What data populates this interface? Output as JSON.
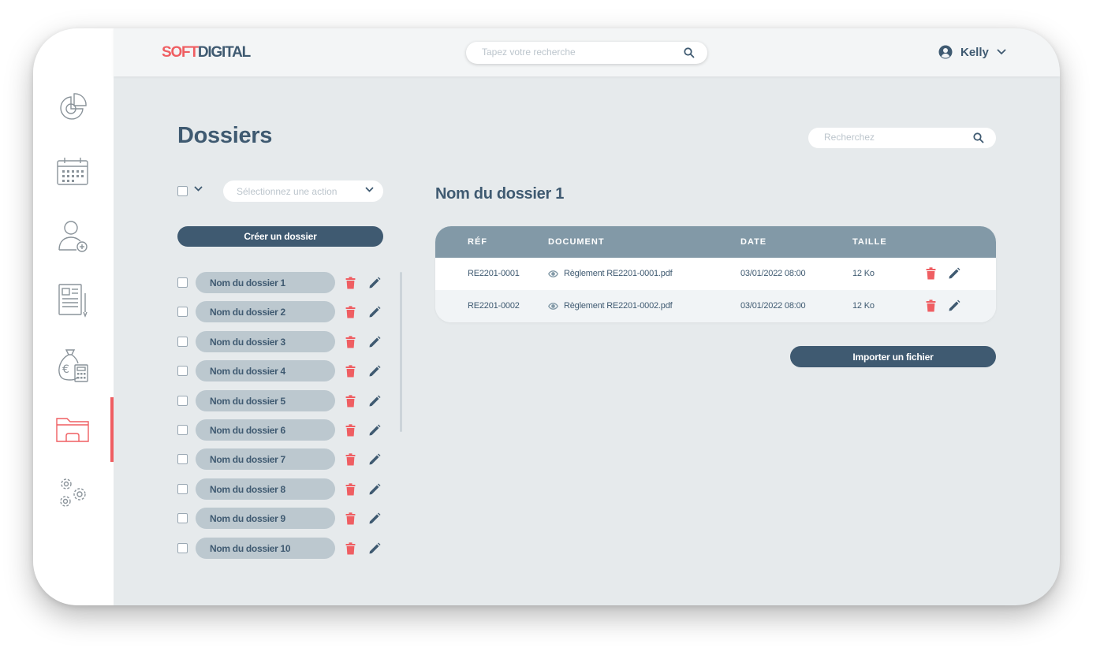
{
  "app": {
    "logo_soft": "SOFT",
    "logo_digital": "DIGITAL",
    "search_placeholder": "Tapez votre recherche",
    "user_name": "Kelly"
  },
  "sidebar": {
    "items": [
      {
        "icon": "pie-chart-icon"
      },
      {
        "icon": "calendar-icon"
      },
      {
        "icon": "add-user-icon"
      },
      {
        "icon": "document-icon"
      },
      {
        "icon": "money-calculator-icon"
      },
      {
        "icon": "folder-icon",
        "active": true
      },
      {
        "icon": "settings-gears-icon"
      }
    ]
  },
  "page": {
    "title": "Dossiers",
    "search_placeholder": "Recherchez",
    "action_placeholder": "Sélectionnez une action",
    "create_button": "Créer un dossier",
    "folders": [
      {
        "name": "Nom du dossier 1"
      },
      {
        "name": "Nom du dossier 2"
      },
      {
        "name": "Nom du dossier 3"
      },
      {
        "name": "Nom du dossier 4"
      },
      {
        "name": "Nom du dossier 5"
      },
      {
        "name": "Nom du dossier 6"
      },
      {
        "name": "Nom du dossier 7"
      },
      {
        "name": "Nom du dossier 8"
      },
      {
        "name": "Nom du dossier 9"
      },
      {
        "name": "Nom du dossier 10"
      }
    ],
    "selected_folder": "Nom du dossier 1",
    "table": {
      "columns": [
        "RÉF",
        "DOCUMENT",
        "DATE",
        "TAILLE"
      ],
      "rows": [
        {
          "ref": "RE2201-0001",
          "document": "Règlement RE2201-0001.pdf",
          "date": "03/01/2022 08:00",
          "size": "12 Ko"
        },
        {
          "ref": "RE2201-0002",
          "document": "Règlement RE2201-0002.pdf",
          "date": "03/01/2022 08:00",
          "size": "12 Ko"
        }
      ]
    },
    "import_button": "Importer un fichier"
  },
  "colors": {
    "primary": "#3f5a71",
    "accent": "#ef5e62",
    "table_header": "#8299a7",
    "folder_pill": "#bcc8cf",
    "background": "#e6eaec"
  }
}
